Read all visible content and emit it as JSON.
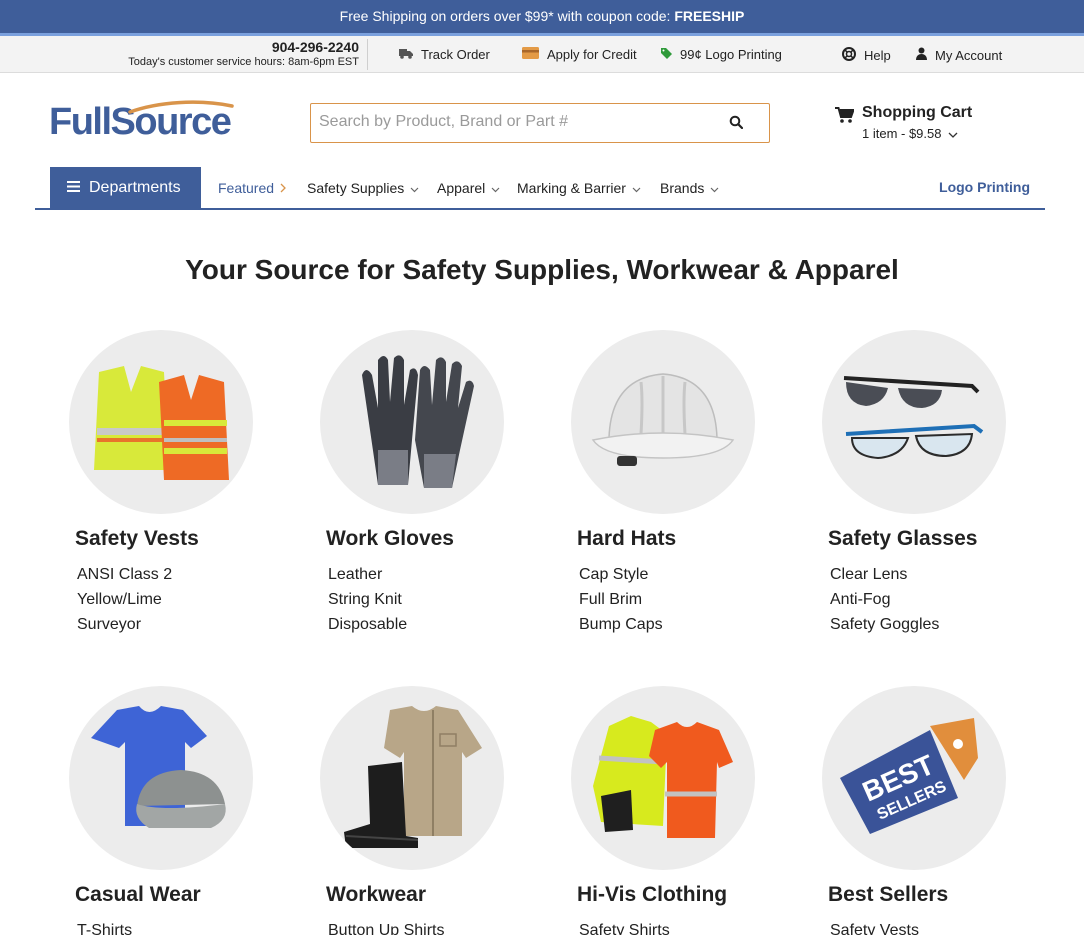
{
  "promo": {
    "text": "Free Shipping on orders over $99* with coupon code: ",
    "code": "FREESHIP"
  },
  "utility": {
    "phone": "904-296-2240",
    "hours": "Today's customer service hours: 8am-6pm EST",
    "track": "Track Order",
    "credit": "Apply for Credit",
    "logo_print": "99¢ Logo Printing",
    "help": "Help",
    "account": "My Account"
  },
  "header": {
    "logo": "FullSource",
    "search_placeholder": "Search by Product, Brand or Part #",
    "cart_title": "Shopping Cart",
    "cart_summary": "1 item - $9.58"
  },
  "nav": {
    "departments": "Departments",
    "items": [
      "Featured",
      "Safety Supplies",
      "Apparel",
      "Marking & Barrier",
      "Brands"
    ],
    "logo_printing": "Logo Printing"
  },
  "hero": {
    "title": "Your Source for Safety Supplies, Workwear & Apparel"
  },
  "categories": [
    {
      "title": "Safety Vests",
      "links": [
        "ANSI Class 2",
        "Yellow/Lime",
        "Surveyor"
      ]
    },
    {
      "title": "Work Gloves",
      "links": [
        "Leather",
        "String Knit",
        "Disposable"
      ]
    },
    {
      "title": "Hard Hats",
      "links": [
        "Cap Style",
        "Full Brim",
        "Bump Caps"
      ]
    },
    {
      "title": "Safety Glasses",
      "links": [
        "Clear Lens",
        "Anti-Fog",
        "Safety Goggles"
      ]
    },
    {
      "title": "Casual Wear",
      "links": [
        "T-Shirts"
      ]
    },
    {
      "title": "Workwear",
      "links": [
        "Button Up Shirts"
      ]
    },
    {
      "title": "Hi-Vis Clothing",
      "links": [
        "Safety Shirts"
      ]
    },
    {
      "title": "Best Sellers",
      "links": [
        "Safety Vests"
      ],
      "badge_line1": "BEST",
      "badge_line2": "SELLERS"
    }
  ],
  "colors": {
    "brand": "#3f5e9a",
    "accent": "#d9944a",
    "circle": "#ececec"
  }
}
